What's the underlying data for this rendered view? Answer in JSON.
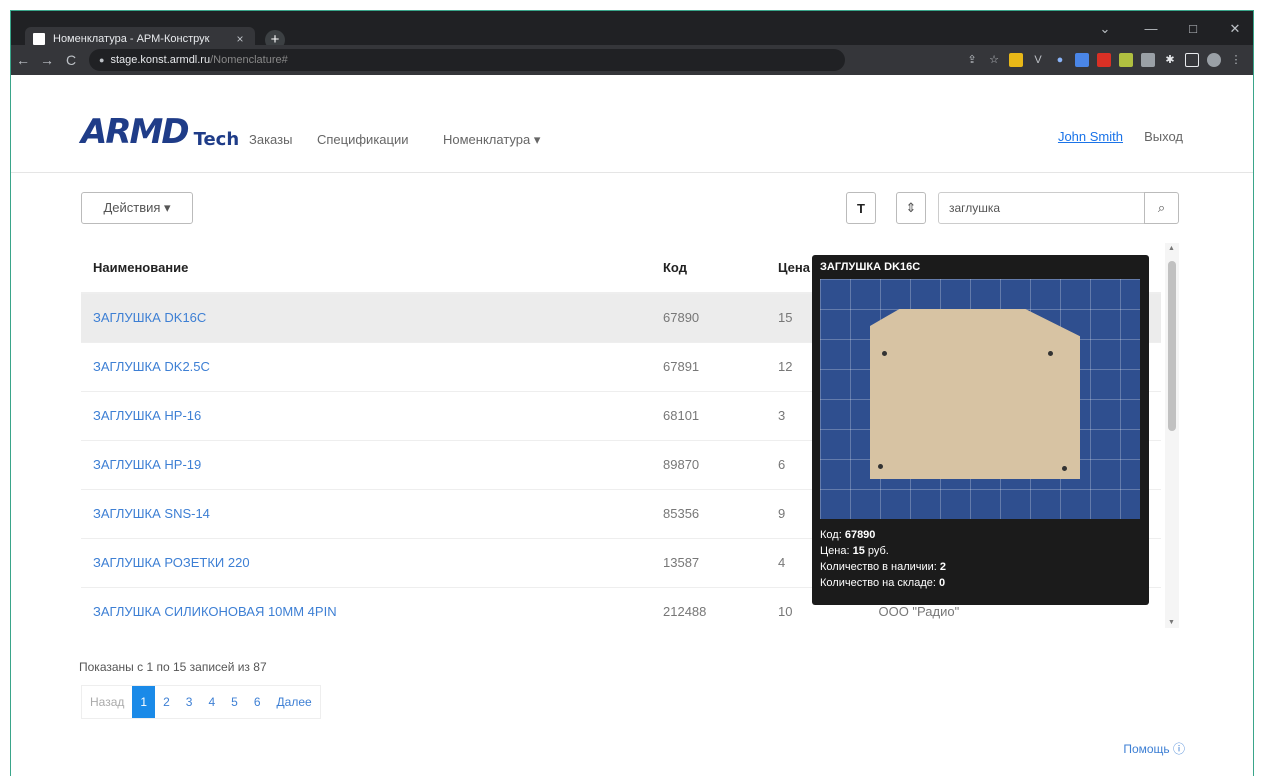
{
  "browser": {
    "tab_title": "Номенклатура - АРМ-Конструк",
    "tab_close": "×",
    "new_tab": "+",
    "url_host": "stage.konst.armdl.ru",
    "url_path": "/Nomenclature#",
    "back": "←",
    "forward": "→",
    "reload": "C",
    "window_controls": [
      "⌄",
      "—",
      "□",
      "✕"
    ]
  },
  "navbar": {
    "logo_text": "ARMD",
    "logo_tech": "Tech",
    "links": [
      "Заказы",
      "Спецификации",
      "Номенклатура ▾"
    ],
    "user": "John Smith",
    "logout": "Выход"
  },
  "toolbar": {
    "actions_label": "Действия ▾",
    "filter_icon": "T",
    "sort_icon": "⇕",
    "search_value": "заглушка",
    "search_icon": "⌕"
  },
  "table": {
    "headers": [
      "Наименование",
      "Код",
      "Цена"
    ],
    "rows": [
      {
        "name": "ЗАГЛУШКА DK16C",
        "code": "67890",
        "price": "15",
        "selected": true
      },
      {
        "name": "ЗАГЛУШКА DK2.5C",
        "code": "67891",
        "price": "12"
      },
      {
        "name": "ЗАГЛУШКА HP-16",
        "code": "68101",
        "price": "3"
      },
      {
        "name": "ЗАГЛУШКА HP-19",
        "code": "89870",
        "price": "6"
      },
      {
        "name": "ЗАГЛУШКА SNS-14",
        "code": "85356",
        "price": "9"
      },
      {
        "name": "ЗАГЛУШКА РОЗЕТКИ 220",
        "code": "13587",
        "price": "4"
      },
      {
        "name": "ЗАГЛУШКА СИЛИКОНОВАЯ 10ММ 4PIN",
        "code": "212488",
        "price": "10",
        "supplier": "ООО \"Радио\""
      }
    ]
  },
  "popover": {
    "title": "ЗАГЛУШКА DK16C",
    "code_label": "Код:",
    "code": "67890",
    "price_label": "Цена:",
    "price": "15",
    "price_unit": "руб.",
    "stock_label": "Количество в наличии:",
    "stock": "2",
    "warehouse_label": "Количество на складе:",
    "warehouse": "0"
  },
  "pagination": {
    "summary": "Показаны с 1 по 15 записей из 87",
    "prev": "Назад",
    "pages": [
      "1",
      "2",
      "3",
      "4",
      "5",
      "6"
    ],
    "next": "Далее",
    "current": 1
  },
  "footer": {
    "help": "Помощь ⓘ"
  }
}
